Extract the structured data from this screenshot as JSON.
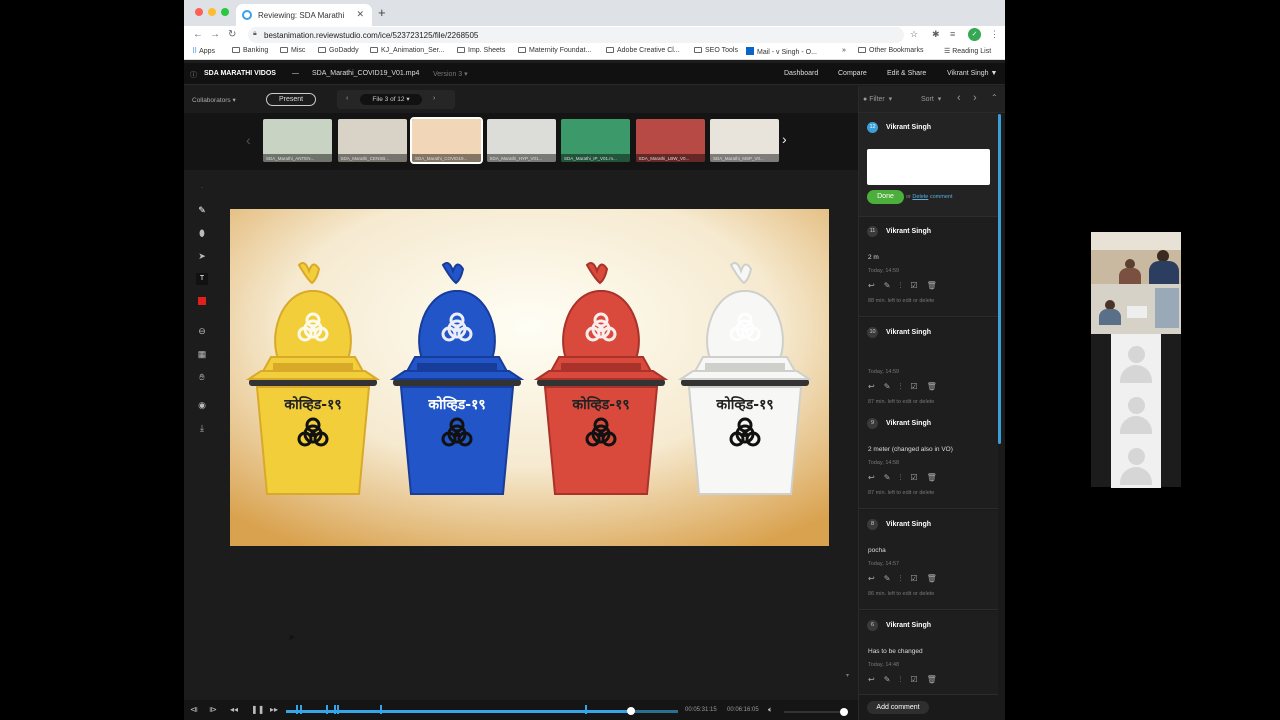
{
  "browser": {
    "tab_title": "Reviewing: SDA Marathi",
    "url": "bestanimation.reviewstudio.com/ice/523723125/file/2268505",
    "bookmarks": [
      "Apps",
      "Banking",
      "Misc",
      "GoDaddy",
      "KJ_Animation_Ser...",
      "Imp. Sheets",
      "Maternity Foundat...",
      "Adobe Creative Cl...",
      "SEO Tools",
      "Mail - v Singh - O...",
      "»",
      "Other Bookmarks",
      "Reading List"
    ]
  },
  "app": {
    "project": "SDA MARATHI VIDOS",
    "separator": "—",
    "filename": "SDA_Marathi_COVID19_V01.mp4",
    "version": "Version 3",
    "nav": [
      "Dashboard",
      "Compare",
      "Edit & Share"
    ],
    "user": "Vikrant Singh ▼"
  },
  "toolbar": {
    "collaborators": "Collaborators ▾",
    "present": "Present",
    "file_counter": "File 3 of 12"
  },
  "thumbnails": [
    {
      "label": "SDA_Marathi_ANTEN...",
      "color": "#c9d3c4"
    },
    {
      "label": "SDA_Marathi_CENSB...",
      "color": "#d9d3c7"
    },
    {
      "label": "SDA_Marathi_COVID19...",
      "color": "#f2d6b8"
    },
    {
      "label": "SDA_Marathi_HYP_V01...",
      "color": "#dcdcd8"
    },
    {
      "label": "SDA_Marathi_IP_V01.m...",
      "color": "#3c9a6a"
    },
    {
      "label": "SDA_Marathi_LBW_V0...",
      "color": "#b84a46"
    },
    {
      "label": "SDA_Marathi_MSP_V0...",
      "color": "#e8e4dc"
    }
  ],
  "artwork": {
    "bins": [
      {
        "label": "कोव्हिड-१९",
        "color": "#f2cf3a",
        "shade": "#d9a92a",
        "text_color": "#222"
      },
      {
        "label": "कोव्हिड-१९",
        "color": "#2255c8",
        "shade": "#173c9a",
        "text_color": "#fff"
      },
      {
        "label": "कोव्हिड-१९",
        "color": "#d94a3c",
        "shade": "#a9322a",
        "text_color": "#222"
      },
      {
        "label": "कोव्हिड-१९",
        "color": "#f7f7f5",
        "shade": "#cfcfcc",
        "text_color": "#222"
      }
    ]
  },
  "panel": {
    "filter": "Filter",
    "sort": "Sort",
    "active_comment": {
      "number": "12",
      "author": "Vikrant Singh",
      "done": "Done",
      "or_text": "or",
      "delete": "Delete",
      "comment_word": "comment"
    },
    "comments": [
      {
        "number": "11",
        "author": "Vikrant Singh",
        "text": "2 m",
        "time": "Today, 14:59",
        "note": "88 min. left to edit or delete"
      },
      {
        "number": "10",
        "author": "Vikrant Singh",
        "text": "",
        "time": "Today, 14:59",
        "note": "87 min. left to edit or delete"
      },
      {
        "number": "9",
        "author": "Vikrant Singh",
        "text": "2 meter (changed also in VO)",
        "time": "Today, 14:58",
        "note": "87 min. left to edit or delete"
      },
      {
        "number": "8",
        "author": "Vikrant Singh",
        "text": "pocha",
        "time": "Today, 14:57",
        "note": "86 min. left to edit or delete"
      },
      {
        "number": "6",
        "author": "Vikrant Singh",
        "text": "Has to be changed",
        "time": "Today, 14:48",
        "note": ""
      }
    ],
    "add_comment": "Add comment"
  },
  "player": {
    "current_time": "00:05:31:15",
    "total_time": "00:06:16:05",
    "progress": 0.88
  }
}
